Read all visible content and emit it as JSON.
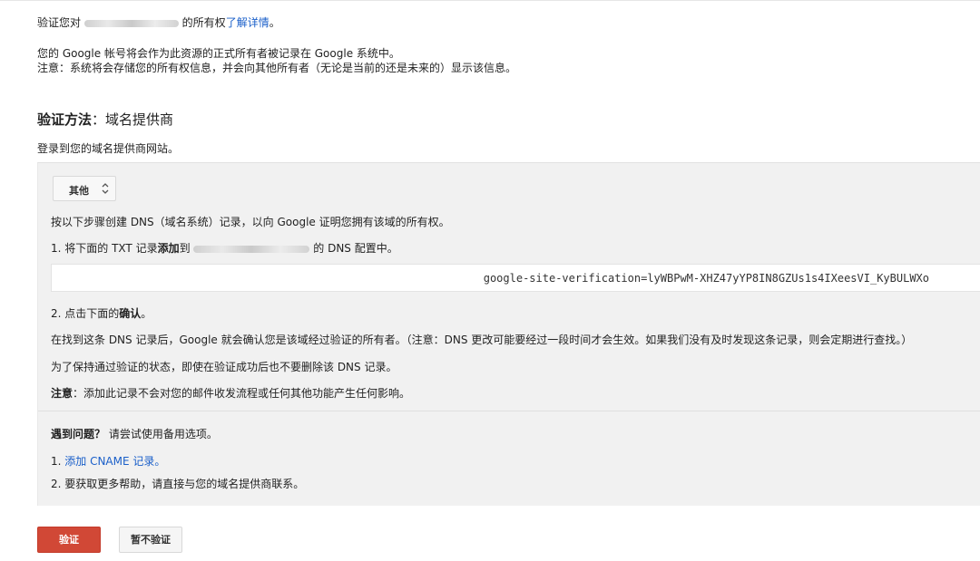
{
  "intro": {
    "verify_prefix": "验证您对",
    "verify_suffix": "的所有权",
    "learn_more": "了解详情",
    "learn_more_period": "。",
    "line2": "您的 Google 帐号将会作为此资源的正式所有者被记录在 Google 系统中。",
    "line3": "注意：系统将会存储您的所有权信息，并会向其他所有者（无论是当前的还是未来的）显示该信息。"
  },
  "method": {
    "label": "验证方法",
    "colon": "：",
    "value": "域名提供商",
    "sub": "登录到您的域名提供商网站。"
  },
  "panel": {
    "provider_select": {
      "value": "其他"
    },
    "instruction": "按以下步骤创建 DNS（域名系统）记录，以向 Google 证明您拥有该域的所有权。",
    "step1_prefix": "1. 将下面的 TXT 记录",
    "step1_bold": "添加",
    "step1_mid": "到",
    "step1_suffix": "的 DNS 配置中。",
    "txt_record": "google-site-verification=lyWBPwM-XHZ47yYP8IN8GZUs1s4IXeesVI_KyBULWXo",
    "step2_prefix": "2. 点击下面的",
    "step2_bold": "确认",
    "step2_suffix": "。",
    "para1": "在找到这条 DNS 记录后，Google 就会确认您是该域经过验证的所有者。（注意：DNS 更改可能要经过一段时间才会生效。如果我们没有及时发现这条记录，则会定期进行查找。）",
    "para2": "为了保持通过验证的状态，即使在验证成功后也不要删除该 DNS 记录。",
    "note_bold": "注意",
    "note_rest": "：添加此记录不会对您的邮件收发流程或任何其他功能产生任何影响。",
    "trouble_bold": "遇到问题？",
    "trouble_rest": " 请尝试使用备用选项。",
    "alt1_prefix": "1. ",
    "alt1_link": "添加 CNAME 记录。",
    "alt2": "2. 要获取更多帮助，请直接与您的域名提供商联系。"
  },
  "buttons": {
    "verify": "验证",
    "not_now": "暂不验证"
  },
  "colors": {
    "link": "#1a5fc9",
    "primary_button": "#d14836",
    "panel_bg": "#f1f1f1"
  }
}
